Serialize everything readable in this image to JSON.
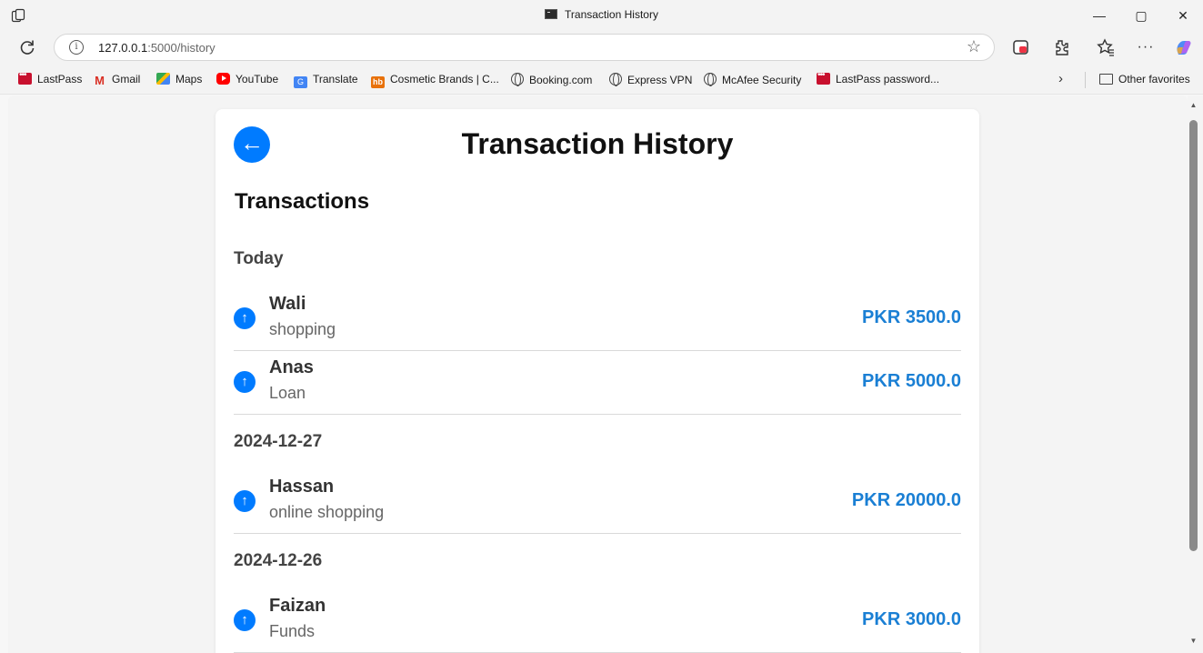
{
  "browser": {
    "tab_title": "Transaction History",
    "url_host": "127.0.0.1",
    "url_rest": ":5000/history",
    "controls": {
      "minimize": "—",
      "maximize": "▢",
      "close": "✕"
    }
  },
  "favorites": [
    {
      "label": "LastPass",
      "icon": "lastpass"
    },
    {
      "label": "Gmail",
      "icon": "gmail"
    },
    {
      "label": "Maps",
      "icon": "maps"
    },
    {
      "label": "YouTube",
      "icon": "youtube"
    },
    {
      "label": "Translate",
      "icon": "translate"
    },
    {
      "label": "Cosmetic Brands | C...",
      "icon": "hb"
    },
    {
      "label": "Booking.com",
      "icon": "globe"
    },
    {
      "label": "Express VPN",
      "icon": "globe"
    },
    {
      "label": "McAfee Security",
      "icon": "globe"
    },
    {
      "label": "LastPass password...",
      "icon": "lastpass"
    }
  ],
  "other_favorites": "Other favorites",
  "page": {
    "back_icon": "←",
    "title": "Transaction History",
    "section_title": "Transactions",
    "direction_icon": "↑",
    "groups": [
      {
        "label": "Today",
        "items": [
          {
            "name": "Wali",
            "description": "shopping",
            "amount": "PKR 3500.0"
          },
          {
            "name": "Anas",
            "description": "Loan",
            "amount": "PKR 5000.0"
          }
        ]
      },
      {
        "label": "2024-12-27",
        "items": [
          {
            "name": "Hassan",
            "description": "online shopping",
            "amount": "PKR 20000.0"
          }
        ]
      },
      {
        "label": "2024-12-26",
        "items": [
          {
            "name": "Faizan",
            "description": "Funds",
            "amount": "PKR 3000.0"
          }
        ]
      }
    ]
  },
  "colors": {
    "accent": "#007bff",
    "amount": "#1a7fd4"
  }
}
